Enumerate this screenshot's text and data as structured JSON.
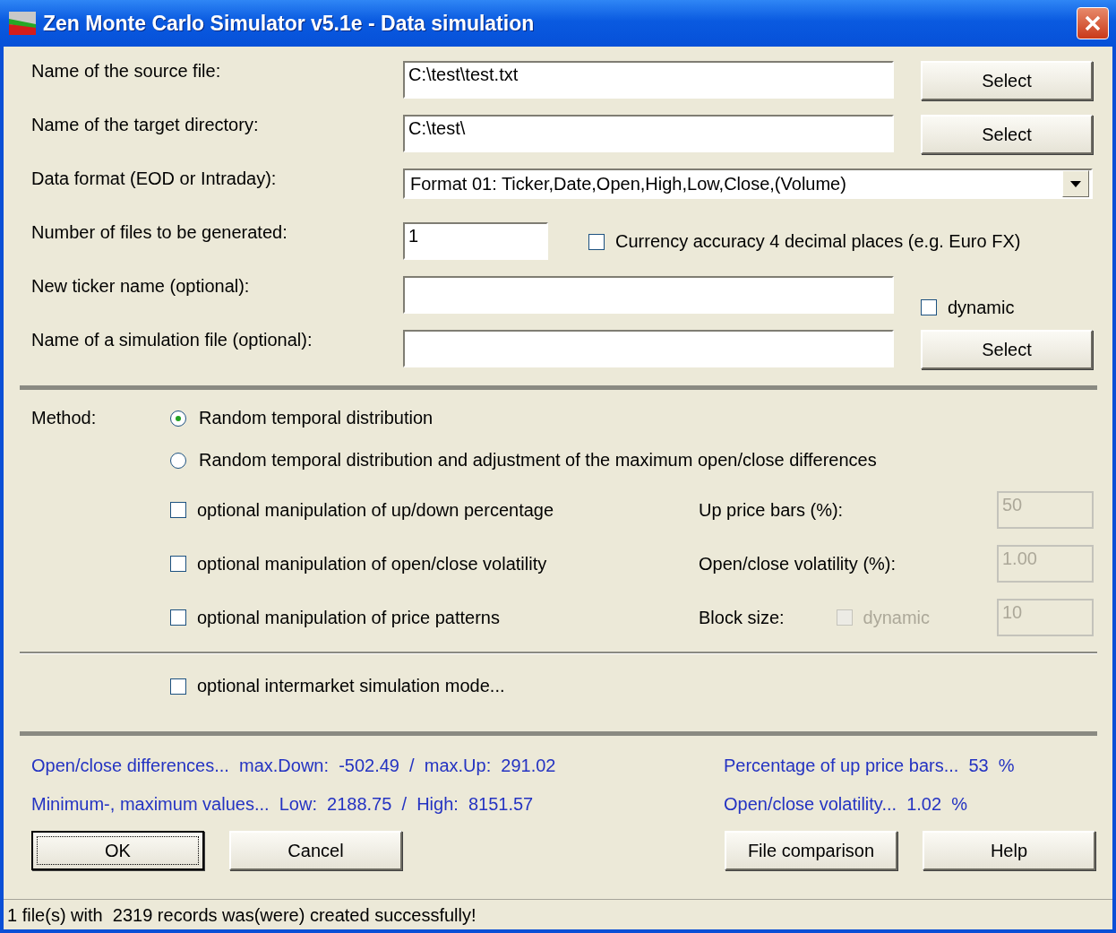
{
  "window": {
    "title": "Zen Monte Carlo Simulator v5.1e - Data simulation"
  },
  "fields": [
    {
      "kind": "text",
      "label": "Name of the source file:",
      "value": "C:\\test\\test.txt",
      "button": "Select"
    },
    {
      "kind": "text",
      "label": "Name of the target directory:",
      "value": "C:\\test\\",
      "button": "Select"
    },
    {
      "kind": "dropdown",
      "label": "Data format (EOD or Intraday):",
      "value": "Format 01: Ticker,Date,Open,High,Low,Close,(Volume)"
    },
    {
      "kind": "short",
      "label": "Number of files to be generated:",
      "value": "1",
      "checkbox": {
        "label": "Currency accuracy 4 decimal places (e.g. Euro FX)",
        "checked": false
      }
    },
    {
      "kind": "text",
      "label": "New ticker name (optional):",
      "checkbox": {
        "label": "dynamic",
        "checked": false
      }
    },
    {
      "kind": "text",
      "label": "Name of a simulation file (optional):",
      "button": "Select"
    }
  ],
  "method": {
    "label": "Method:",
    "options": [
      {
        "label": "Random temporal distribution",
        "selected": true
      },
      {
        "label": "Random temporal distribution and adjustment of the maximum open/close differences",
        "selected": false
      }
    ],
    "manipulations": [
      {
        "label": "optional manipulation of up/down percentage",
        "checked": false,
        "param_label": "Up price bars (%):",
        "param_value": "50",
        "param_disabled": true
      },
      {
        "label": "optional manipulation of open/close volatility",
        "checked": false,
        "param_label": "Open/close volatility (%):",
        "param_value": "1.00",
        "param_disabled": true
      },
      {
        "label": "optional manipulation of price patterns",
        "checked": false,
        "param_label": "Block size:",
        "dynamic": {
          "label": "dynamic",
          "checked": false,
          "disabled": true
        },
        "param_value": "10",
        "param_disabled": true
      }
    ],
    "intermarket": {
      "label": "optional intermarket simulation mode...",
      "checked": false
    }
  },
  "stats": {
    "left": [
      "Open/close differences...  max.Down:  -502.49  /  max.Up:  291.02",
      "Minimum-, maximum values...  Low:  2188.75  /  High:  8151.57"
    ],
    "right": [
      "Percentage of up price bars...  53  %",
      "Open/close volatility...  1.02  %"
    ]
  },
  "buttons": [
    {
      "label": "OK",
      "default": true
    },
    {
      "label": "Cancel",
      "default": false
    },
    {
      "label": "File comparison",
      "default": false
    },
    {
      "label": "Help",
      "default": false
    }
  ],
  "status_bar": "1 file(s) with  2319 records was(were) created successfully!"
}
